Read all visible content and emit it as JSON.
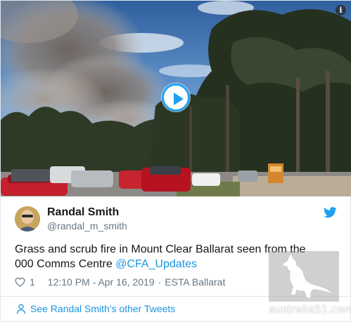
{
  "media": {
    "info_icon": "info-icon",
    "play_icon": "play-icon",
    "accent_color": "#1da1f2"
  },
  "author": {
    "name": "Randal Smith",
    "handle": "@randal_m_smith",
    "avatar_icon": "avatar"
  },
  "brand_icon": "twitter-bird-icon",
  "tweet": {
    "text_part1": "Grass and scrub fire in Mount Clear Ballarat seen from the 000 Comms Centre ",
    "mention": "@CFA_Updates",
    "mention_color": "#1b95e0"
  },
  "meta": {
    "like_icon": "heart-icon",
    "likes": "1",
    "timestamp": "12:10 PM - Apr 16, 2019",
    "separator": "·",
    "source": "ESTA Ballarat"
  },
  "footer": {
    "icon": "person-icon",
    "link_text": "See Randal Smith's other Tweets"
  },
  "watermark": {
    "text": "australia51.com",
    "icon": "kangaroo-icon"
  }
}
